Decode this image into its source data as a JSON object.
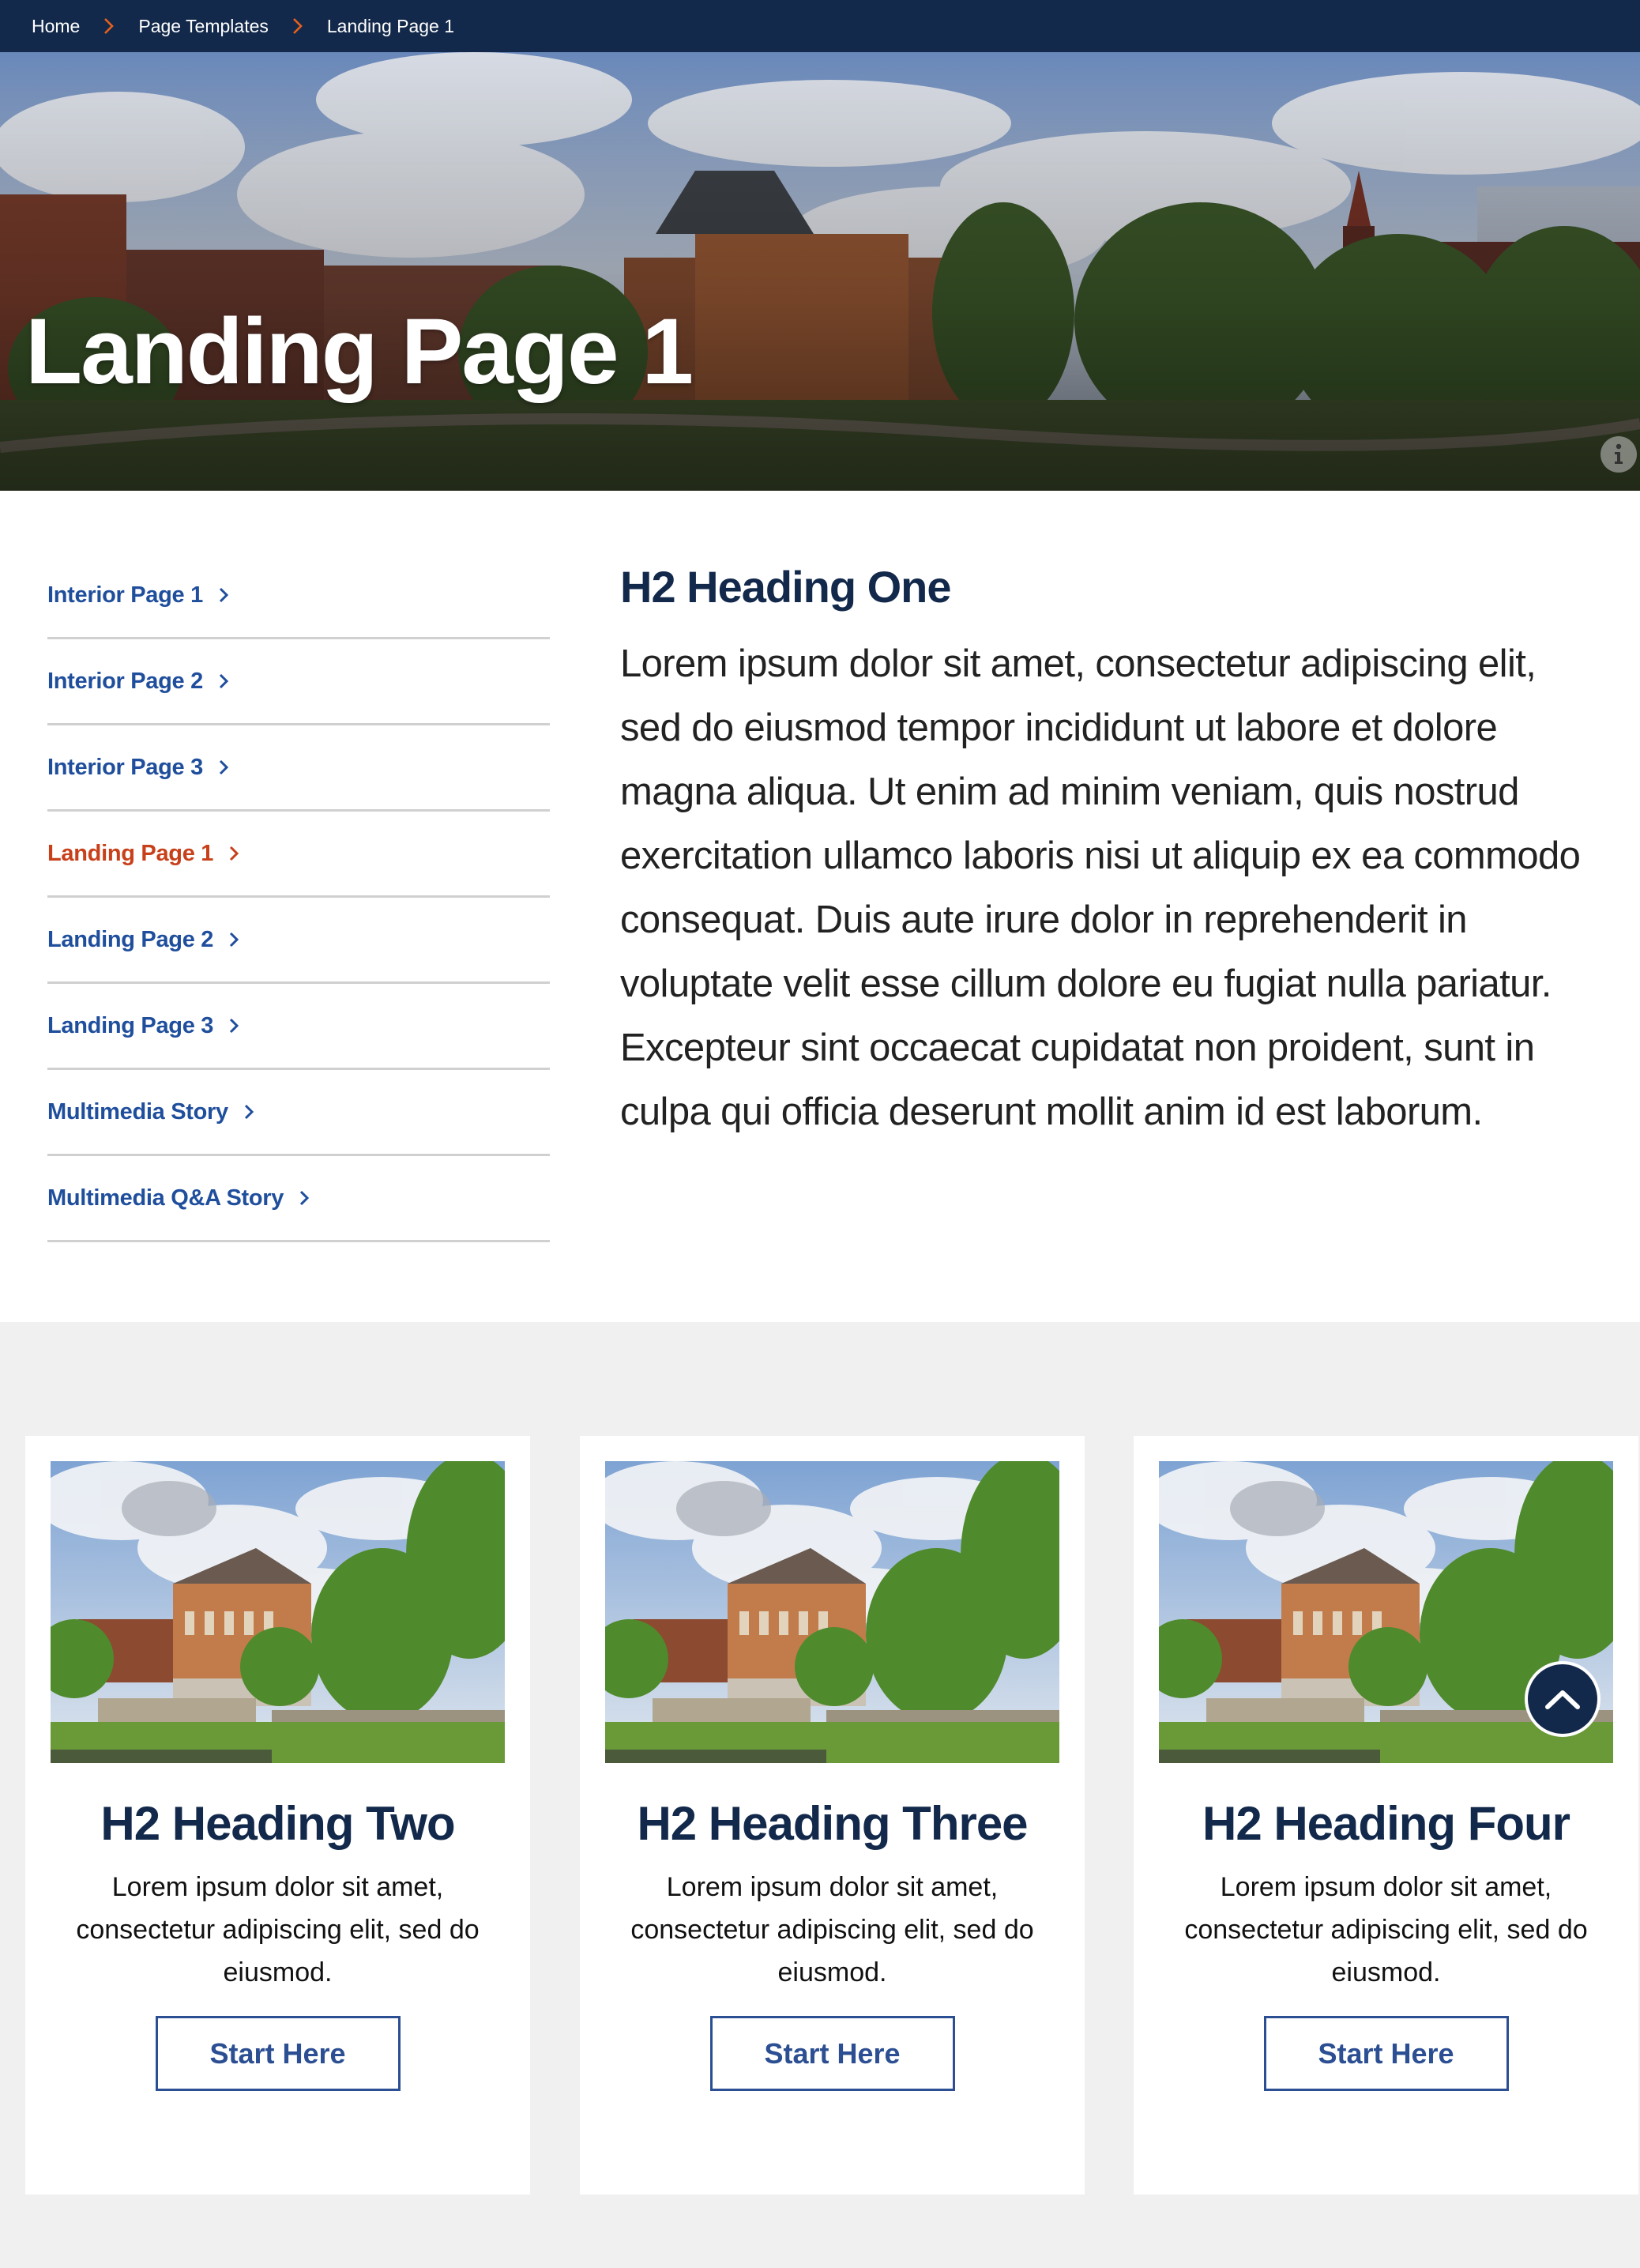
{
  "breadcrumb": {
    "items": [
      "Home",
      "Page Templates",
      "Landing Page 1"
    ],
    "separator_icon": "chevron-right-icon",
    "separator_color": "#e8601c"
  },
  "hero": {
    "title": "Landing Page 1",
    "info_icon": "info-icon"
  },
  "sidebar": {
    "items": [
      {
        "label": "Interior Page 1",
        "active": false
      },
      {
        "label": "Interior Page 2",
        "active": false
      },
      {
        "label": "Interior Page 3",
        "active": false
      },
      {
        "label": "Landing Page 1",
        "active": true
      },
      {
        "label": "Landing Page 2",
        "active": false
      },
      {
        "label": "Landing Page 3",
        "active": false
      },
      {
        "label": "Multimedia Story",
        "active": false
      },
      {
        "label": "Multimedia Q&A Story",
        "active": false
      }
    ],
    "link_color": "#1f4e9c",
    "active_color": "#c8401a"
  },
  "intro": {
    "heading": "H2 Heading One",
    "body": "Lorem ipsum dolor sit amet, consectetur adipiscing elit, sed do eiusmod tempor incididunt ut labore et dolore magna aliqua. Ut enim ad minim veniam, quis nostrud exercitation ullamco laboris nisi ut aliquip ex ea commodo consequat. Duis aute irure dolor in reprehenderit in voluptate velit esse cillum dolore eu fugiat nulla pariatur. Excepteur sint occaecat cupidatat non proident, sunt in culpa qui officia deserunt mollit anim id est laborum."
  },
  "cards": [
    {
      "heading": "H2 Heading Two",
      "body": "Lorem ipsum dolor sit amet, consectetur adipiscing elit, sed do eiusmod.",
      "button": "Start Here"
    },
    {
      "heading": "H2 Heading Three",
      "body": "Lorem ipsum dolor sit amet, consectetur adipiscing elit, sed do eiusmod.",
      "button": "Start Here"
    },
    {
      "heading": "H2 Heading Four",
      "body": "Lorem ipsum dolor sit amet, consectetur adipiscing elit, sed do eiusmod.",
      "button": "Start Here"
    }
  ],
  "back_to_top": {
    "icon": "chevron-up-icon"
  },
  "colors": {
    "navy": "#13294b",
    "orange": "#e8601c",
    "band_gray": "#f0f0f0",
    "button_blue": "#2b4f92"
  }
}
